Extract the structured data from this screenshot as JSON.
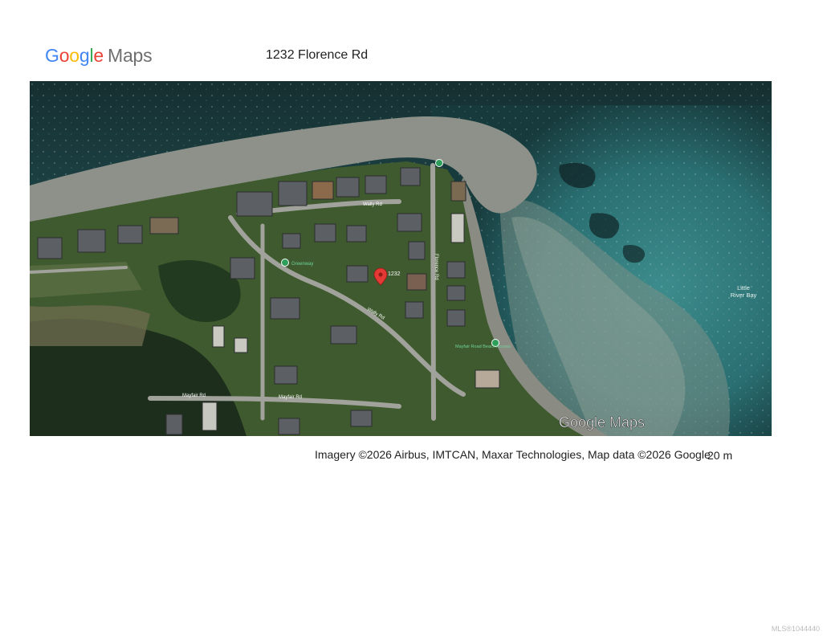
{
  "header": {
    "logo_letters": [
      {
        "ch": "G",
        "color": "#4285F4"
      },
      {
        "ch": "o",
        "color": "#EA4335"
      },
      {
        "ch": "o",
        "color": "#FBBC05"
      },
      {
        "ch": "g",
        "color": "#4285F4"
      },
      {
        "ch": "l",
        "color": "#34A853"
      },
      {
        "ch": "e",
        "color": "#EA4335"
      }
    ],
    "logo_suffix": "Maps",
    "address": "1232 Florence Rd"
  },
  "map": {
    "view": "satellite",
    "marker_label": "1232",
    "marker_color": "#e53935",
    "water_label_line1": "Little",
    "water_label_line2": "River Bay",
    "watermark": "Google Maps",
    "road_labels": {
      "wally_top": "Wally Rd",
      "wally_diag": "Wally Rd",
      "florence": "Florence Rd",
      "mayfair_left": "Mayfair Rd",
      "mayfair_right": "Mayfair Rd"
    },
    "poi_labels": {
      "greenway": "Greenway",
      "beach_access": "Mayfair Road Beach Access"
    },
    "colors": {
      "deep_water": "#1a3a3d",
      "shallow_water": "#2f7f82",
      "beach": "#8c8f85",
      "vegetation": "#3f5a2e",
      "trees": "#1d2f1c",
      "road": "#9a9a93"
    }
  },
  "footer": {
    "attribution": "Imagery ©2026 Airbus, IMTCAN, Maxar Technologies, Map data ©2026 Google",
    "scale": "20 m",
    "mls": "MLS®1044440"
  }
}
